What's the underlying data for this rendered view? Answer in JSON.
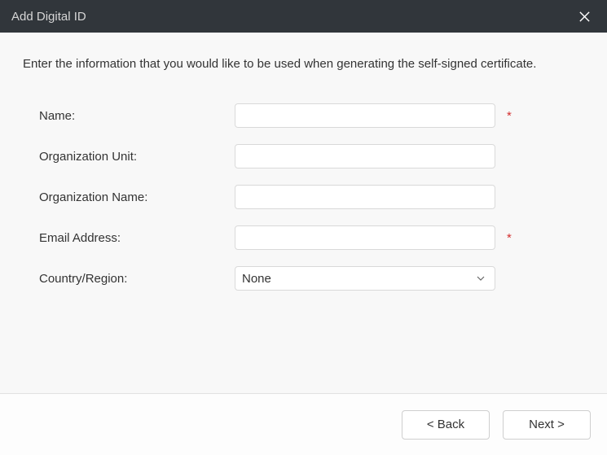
{
  "titlebar": {
    "title": "Add Digital ID"
  },
  "instruction": "Enter the information that you would like to be used when generating the self-signed certificate.",
  "form": {
    "name": {
      "label": "Name:",
      "value": "",
      "required_mark": "*"
    },
    "org_unit": {
      "label": "Organization Unit:",
      "value": ""
    },
    "org_name": {
      "label": "Organization Name:",
      "value": ""
    },
    "email": {
      "label": "Email Address:",
      "value": "",
      "required_mark": "*"
    },
    "country": {
      "label": "Country/Region:",
      "selected": "None"
    }
  },
  "footer": {
    "back_label": "< Back",
    "next_label": "Next >"
  }
}
